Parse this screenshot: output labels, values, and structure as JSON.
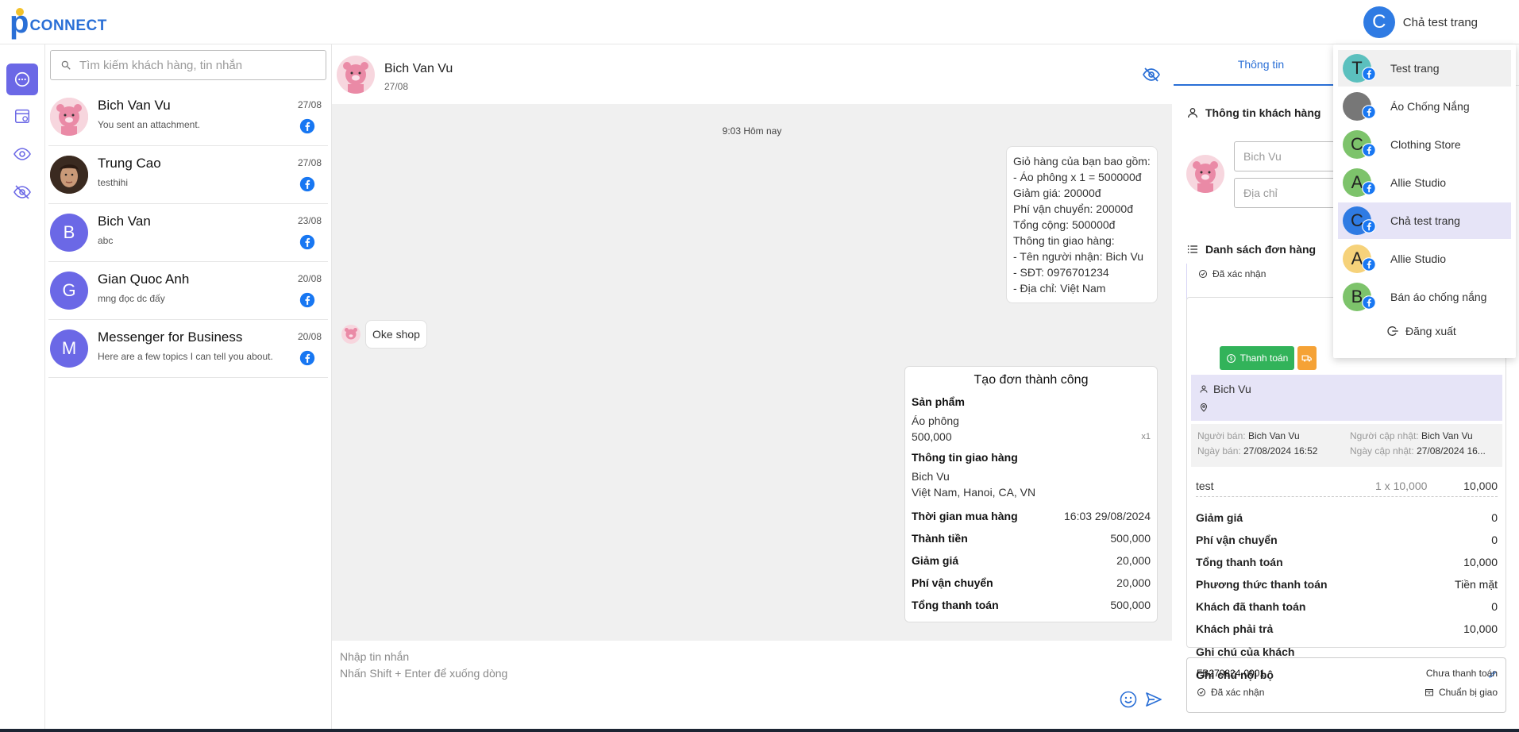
{
  "brand": {
    "logo_letter": "p",
    "logo_text": "CONNECT"
  },
  "user": {
    "initial": "C",
    "name": "Chả test trang"
  },
  "search": {
    "placeholder": "Tìm kiếm khách hàng, tin nhắn"
  },
  "conversations": [
    {
      "name": "Bich Van Vu",
      "last_message": "You sent an attachment.",
      "date": "27/08",
      "initial": ""
    },
    {
      "name": "Trung Cao",
      "last_message": "testhihi",
      "date": "27/08",
      "initial": ""
    },
    {
      "name": "Bich Van",
      "last_message": "abc",
      "date": "23/08",
      "initial": "B"
    },
    {
      "name": "Gian Quoc Anh",
      "last_message": "mng đọc dc đấy",
      "date": "20/08",
      "initial": "G"
    },
    {
      "name": "Messenger for Business",
      "last_message": "Here are a few topics I can tell you about.",
      "date": "20/08",
      "initial": "M"
    }
  ],
  "chat": {
    "contact_name": "Bich Van Vu",
    "contact_date": "27/08",
    "timestamp": "9:03 Hôm nay",
    "outgoing_message": "Giỏ hàng của bạn bao gồm:\n- Áo phông x 1 = 500000đ\nGiảm giá: 20000đ\nPhí vận chuyển: 20000đ\nTổng cộng: 500000đ\nThông tin giao hàng:\n- Tên người nhận: Bich Vu\n- SĐT: 0976701234\n- Địa chỉ: Việt Nam",
    "incoming_message": "Oke shop",
    "order_card": {
      "title": "Tạo đơn thành công",
      "products_label": "Sản phẩm",
      "product_name": "Áo phông",
      "product_price": "500,000",
      "product_qty": "x1",
      "shipping_label": "Thông tin giao hàng",
      "shipping_name": "Bich Vu",
      "shipping_address": "Việt Nam, Hanoi, CA, VN",
      "rows": [
        {
          "label": "Thời gian mua hàng",
          "value": "16:03 29/08/2024"
        },
        {
          "label": "Thành tiền",
          "value": "500,000"
        },
        {
          "label": "Giảm giá",
          "value": "20,000"
        },
        {
          "label": "Phí vận chuyển",
          "value": "20,000"
        },
        {
          "label": "Tổng thanh toán",
          "value": "500,000"
        }
      ]
    },
    "composer_placeholder": "Nhập tin nhắn\nNhấn Shift + Enter để xuống dòng"
  },
  "right_panel": {
    "tab_info": "Thông tin",
    "customer_section": "Thông tin khách hàng",
    "name_placeholder": "Bich Vu",
    "address_placeholder": "Địa chỉ",
    "orders_section": "Danh sách đơn hàng",
    "first_order_status": "Đã xác nhận",
    "pay_button": "Thanh toán",
    "customer_name": "Bich Vu",
    "seller_label": "Người bán:",
    "seller_value": "Bich Van Vu",
    "updater_label": "Người cập nhật:",
    "updater_value": "Bich Van Vu",
    "sale_date_label": "Ngày bán:",
    "sale_date_value": "27/08/2024 16:52",
    "update_date_label": "Ngày cập nhật:",
    "update_date_value": "27/08/2024 16...",
    "line_item": {
      "name": "test",
      "qty": "1 x 10,000",
      "amount": "10,000"
    },
    "summary": [
      {
        "label": "Giảm giá",
        "value": "0"
      },
      {
        "label": "Phí vận chuyển",
        "value": "0"
      },
      {
        "label": "Tổng thanh toán",
        "value": "10,000"
      },
      {
        "label": "Phương thức thanh toán",
        "value": "Tiền mặt"
      },
      {
        "label": "Khách đã thanh toán",
        "value": "0"
      },
      {
        "label": "Khách phải trả",
        "value": "10,000"
      },
      {
        "label": "Ghi chú của khách",
        "value": ""
      },
      {
        "label": "Ghi chú nội bộ",
        "value": ""
      }
    ],
    "order2": {
      "code": "FB270824-0001",
      "payment_status": "Chưa thanh toán",
      "status": "Đã xác nhận",
      "shipping_status": "Chuẩn bị giao"
    }
  },
  "page_dropdown": {
    "items": [
      {
        "initial": "T",
        "label": "Test trang",
        "color": "#5bc0be",
        "selected": false
      },
      {
        "initial": "",
        "label": "Áo Chống Nắng",
        "color": "#777777",
        "selected": false
      },
      {
        "initial": "C",
        "label": "Clothing Store",
        "color": "#7dc36b",
        "selected": false
      },
      {
        "initial": "A",
        "label": "Allie Studio",
        "color": "#7dc36b",
        "selected": false
      },
      {
        "initial": "C",
        "label": "Chả test trang",
        "color": "#2f7be3",
        "selected": true
      },
      {
        "initial": "A",
        "label": "Allie Studio",
        "color": "#f6d27a",
        "selected": false
      },
      {
        "initial": "B",
        "label": "Bán áo chống nắng",
        "color": "#7dc36b",
        "selected": false
      }
    ],
    "logout": "Đăng xuất"
  },
  "colors": {
    "accent": "#6b68e6",
    "primary": "#2a6fd6",
    "facebook": "#1877f2",
    "pay": "#32b35a",
    "ship": "#f5a236"
  }
}
